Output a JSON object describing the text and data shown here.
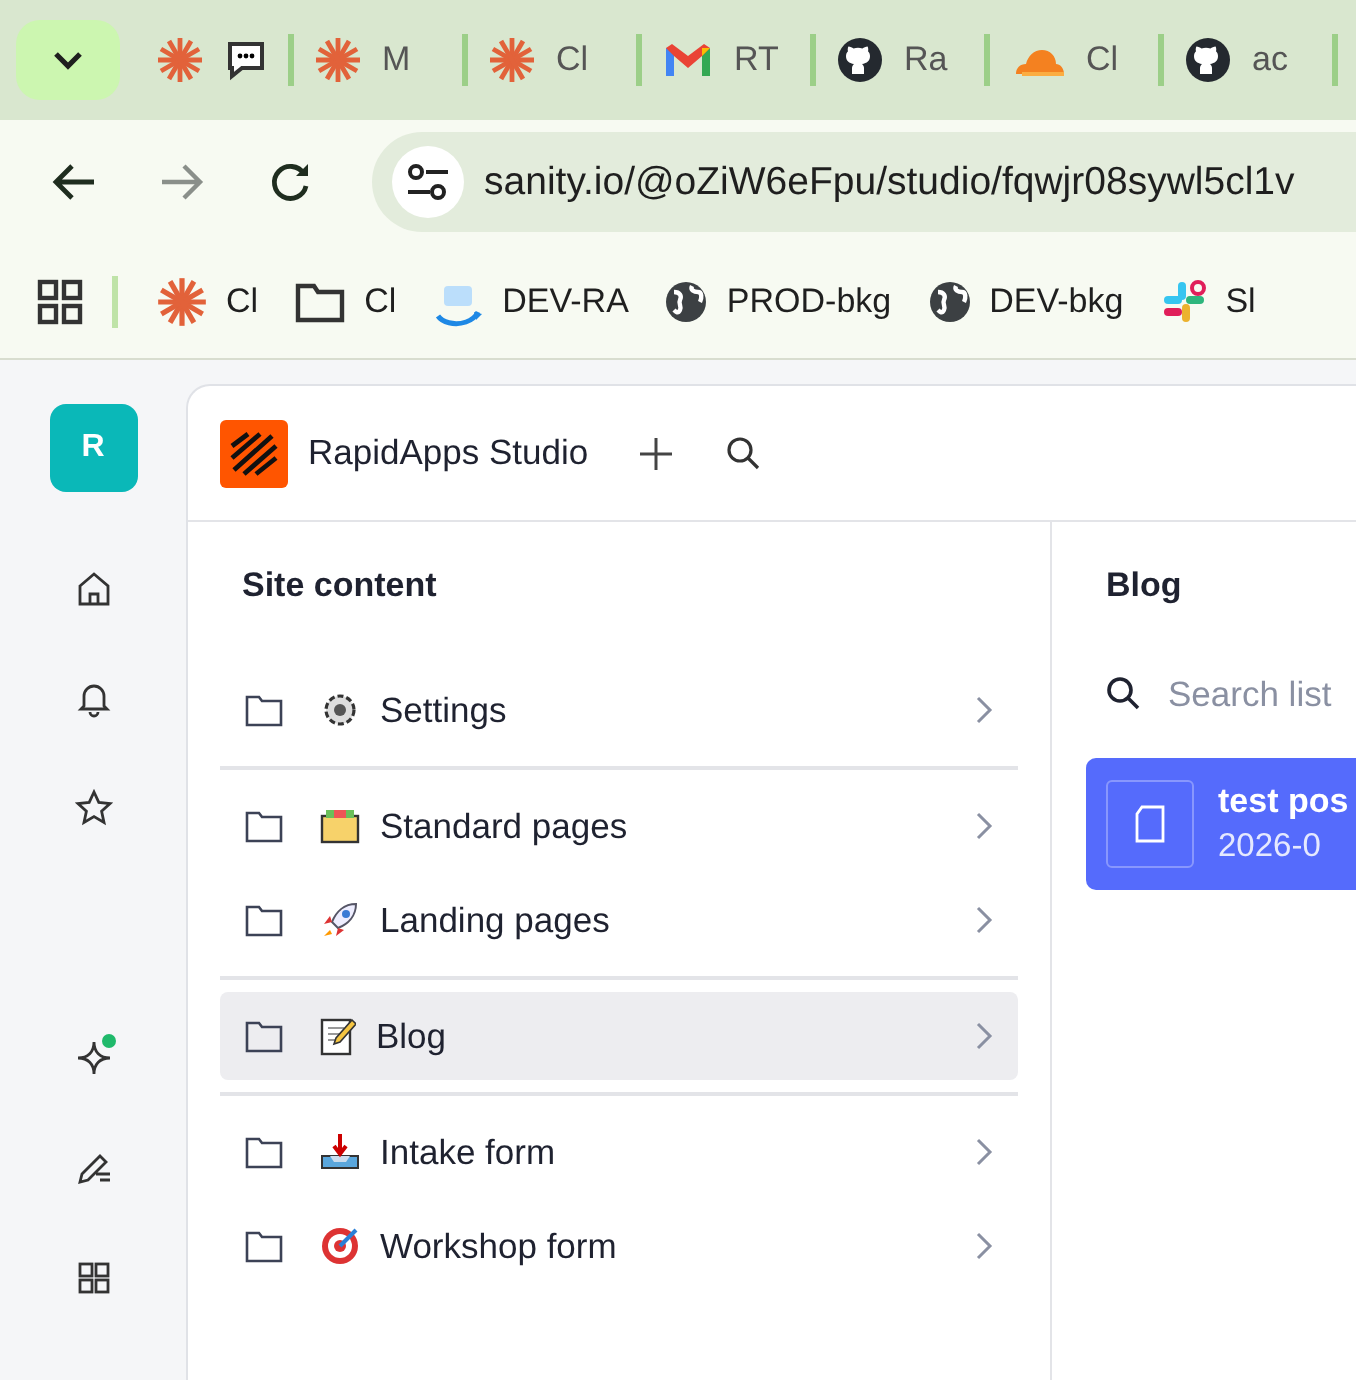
{
  "browser": {
    "tabs": [
      {
        "kind": "icons"
      },
      {
        "kind": "titled",
        "title": "M"
      },
      {
        "kind": "titled",
        "title": "Cl"
      },
      {
        "kind": "titled",
        "title": "RT"
      },
      {
        "kind": "titled",
        "title": "Ra"
      },
      {
        "kind": "titled",
        "title": "Cl"
      },
      {
        "kind": "titled",
        "title": "ac"
      }
    ],
    "address": "sanity.io/@oZiW6eFpu/studio/fqwjr08sywl5cl1v",
    "bookmarks": [
      {
        "title": "Cl"
      },
      {
        "title": "Cl"
      },
      {
        "title": "DEV-RA"
      },
      {
        "title": "PROD-bkg"
      },
      {
        "title": "DEV-bkg"
      },
      {
        "title": "Sl"
      }
    ]
  },
  "studio": {
    "avatar": "R",
    "title": "RapidApps Studio",
    "structure": {
      "title": "Site content",
      "sections": [
        [
          {
            "label": "Settings",
            "selected": false
          }
        ],
        [
          {
            "label": "Standard pages",
            "selected": false
          },
          {
            "label": "Landing pages",
            "selected": false
          }
        ],
        [
          {
            "label": "Blog",
            "selected": true
          }
        ],
        [
          {
            "label": "Intake form",
            "selected": false
          },
          {
            "label": "Workshop form",
            "selected": false
          }
        ]
      ]
    },
    "list": {
      "title": "Blog",
      "search": {
        "placeholder": "Search list"
      },
      "documents": [
        {
          "title": "test pos",
          "subtitle": "2026-0",
          "selected": true
        }
      ]
    }
  }
}
